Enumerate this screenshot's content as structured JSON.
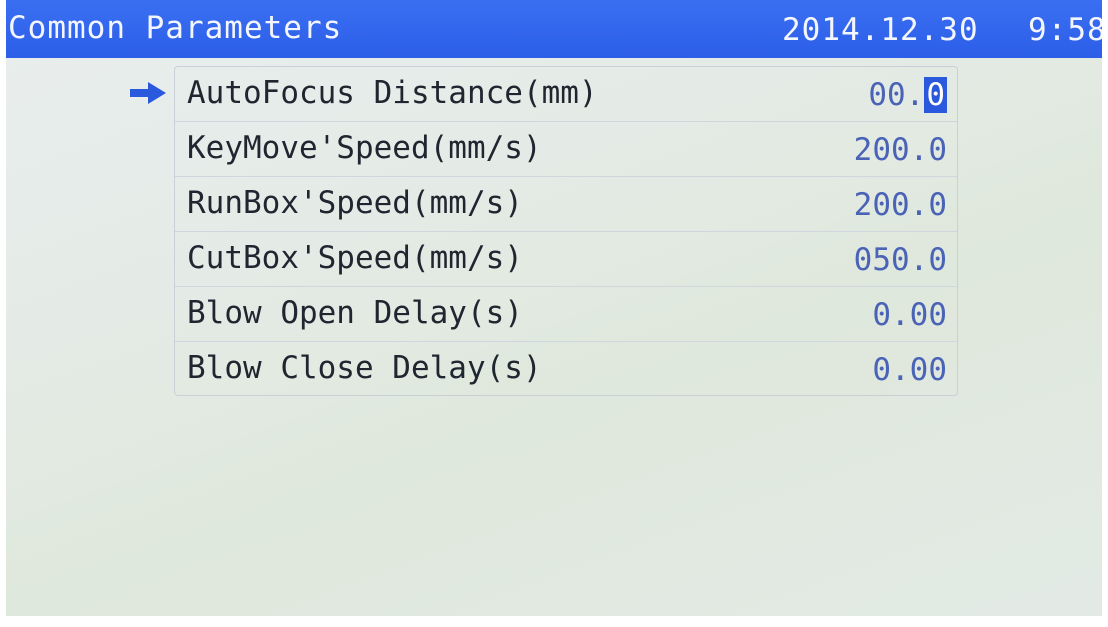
{
  "header": {
    "title": "Common Parameters",
    "date": "2014.12.30",
    "time": "9:58"
  },
  "selection_arrow_icon": "right-arrow-icon",
  "params": [
    {
      "label": "AutoFocus Distance(mm)",
      "value_prefix": "00.",
      "value_cursor": "0"
    },
    {
      "label": "KeyMove'Speed(mm/s)",
      "value": "200.0"
    },
    {
      "label": "RunBox'Speed(mm/s)",
      "value": "200.0"
    },
    {
      "label": "CutBox'Speed(mm/s)",
      "value": "050.0"
    },
    {
      "label": "Blow Open Delay(s)",
      "value": "0.00"
    },
    {
      "label": "Blow Close Delay(s)",
      "value": "0.00"
    }
  ],
  "colors": {
    "header_bg": "#2c5ee8",
    "value_text": "#4a63b7",
    "cursor_bg": "#2b59dd",
    "arrow": "#2b59dd"
  }
}
